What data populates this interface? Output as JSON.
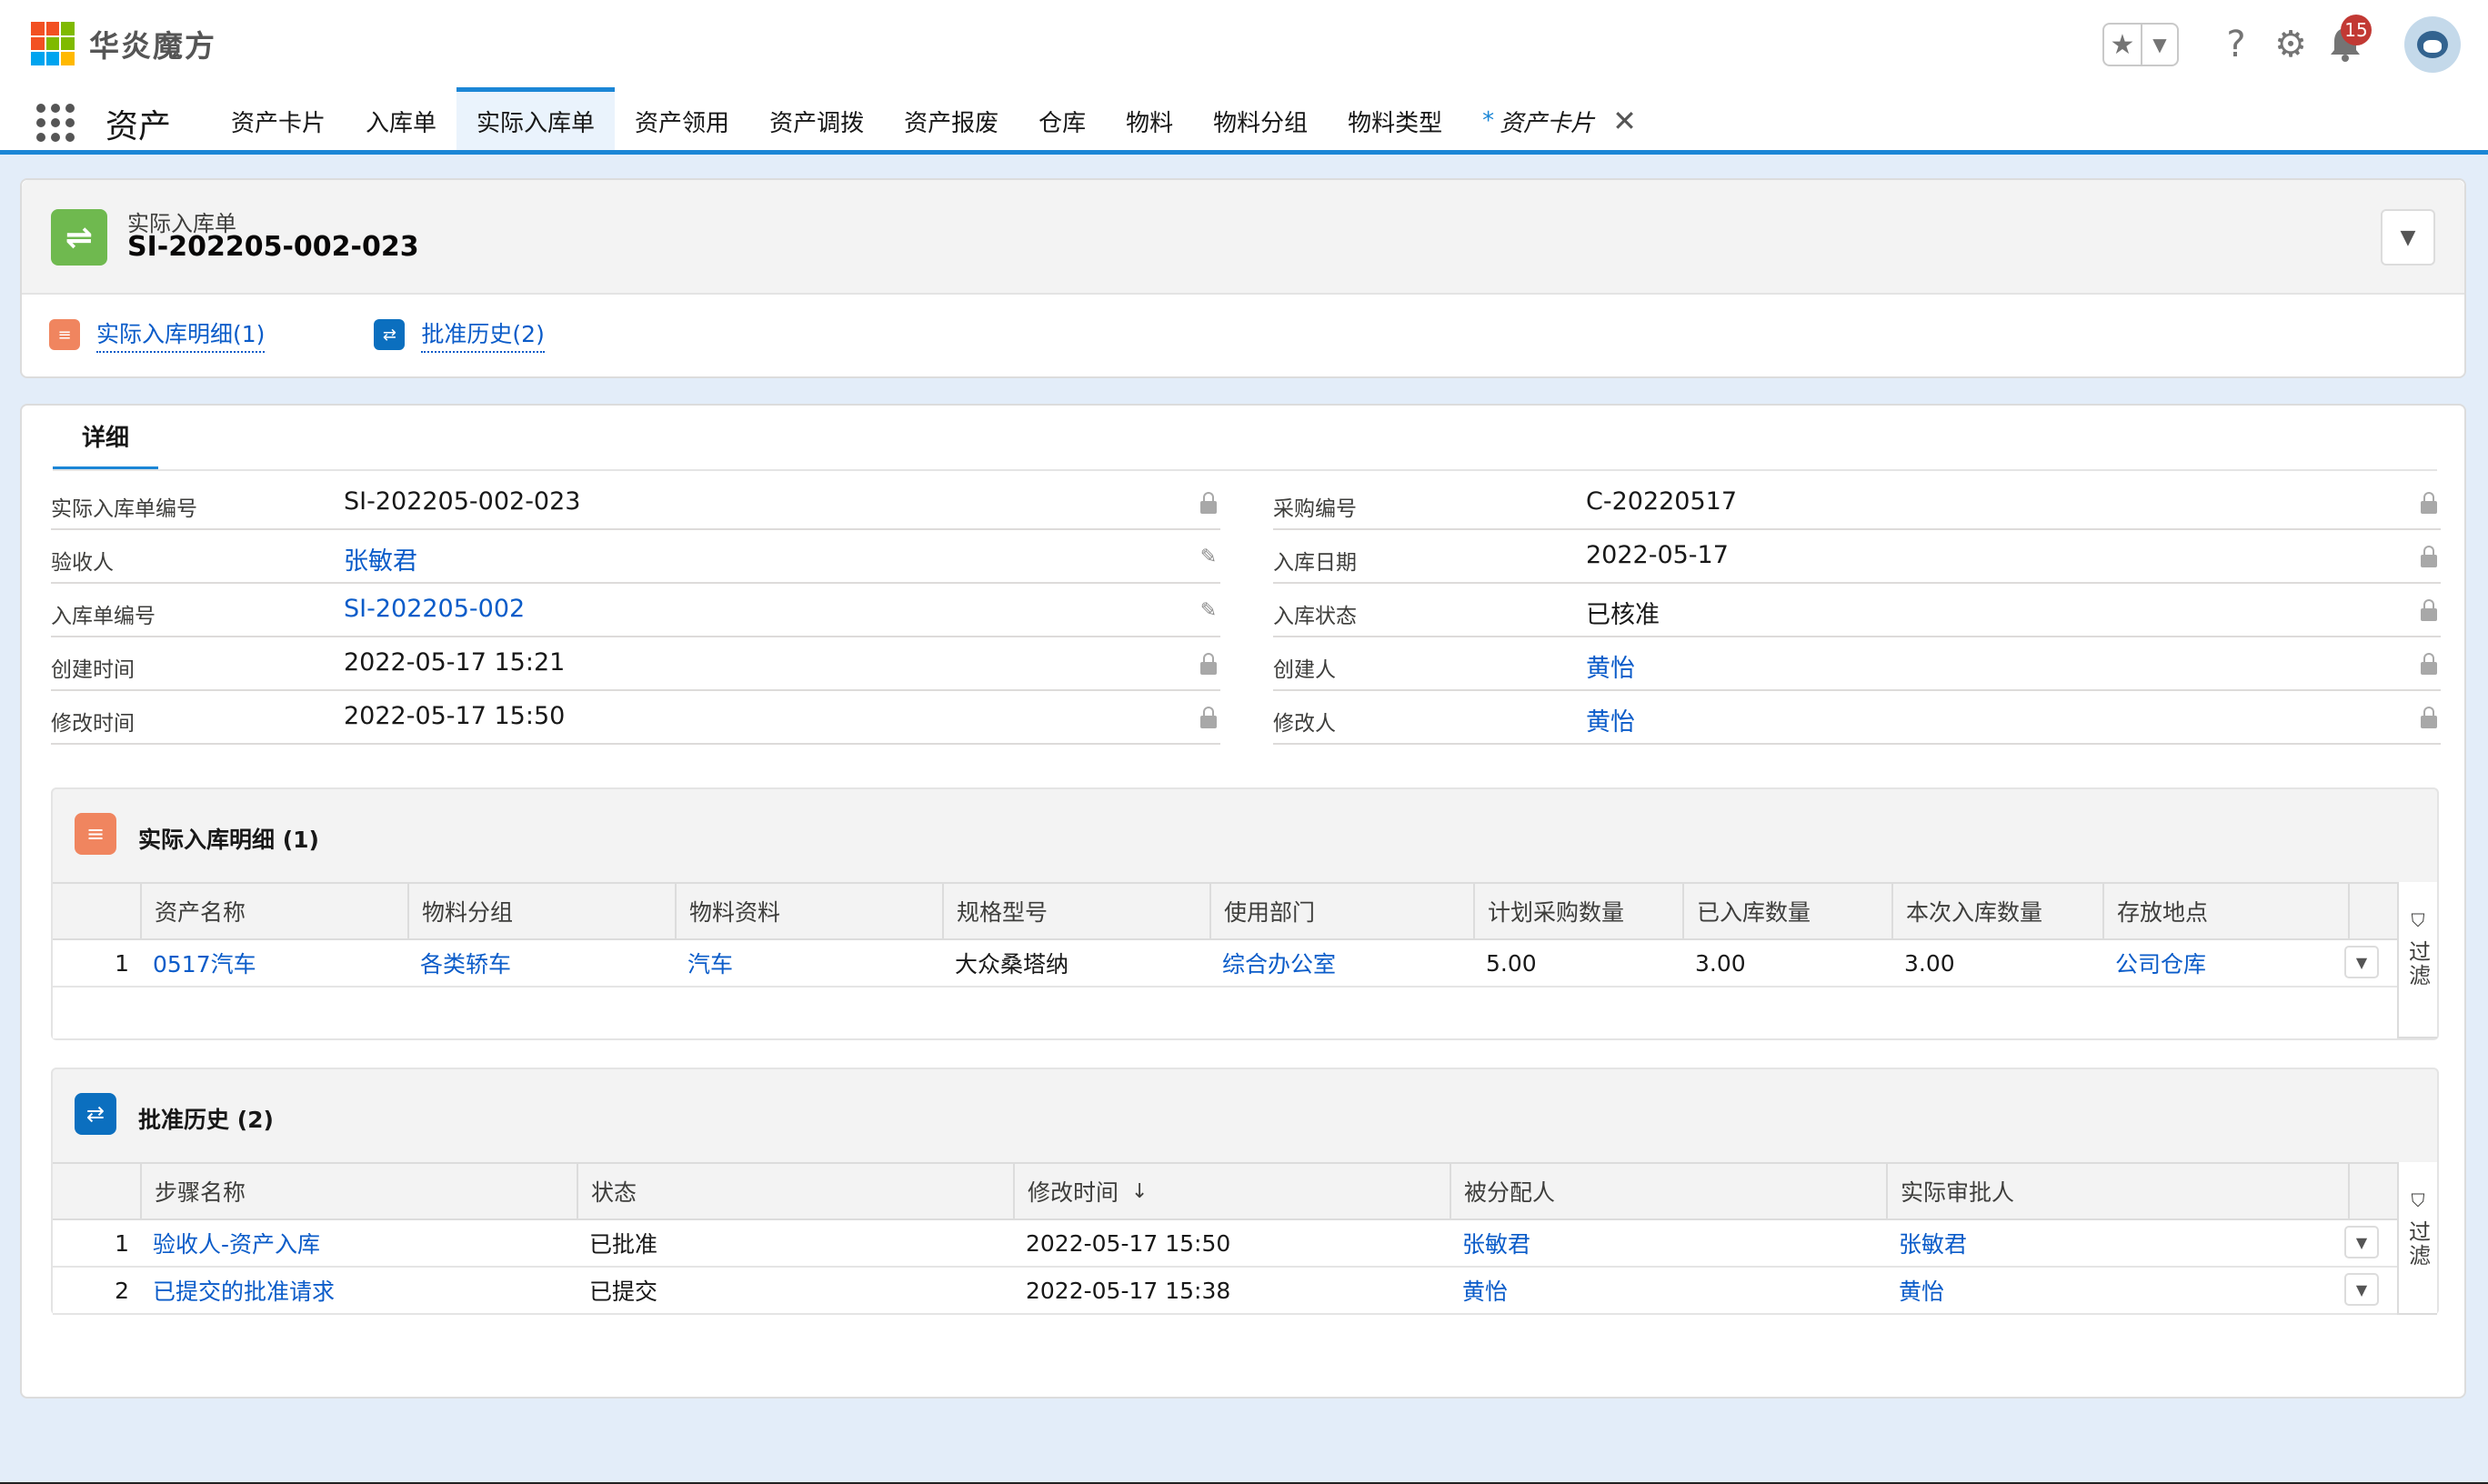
{
  "header": {
    "logo_text": "华炎魔方",
    "logo_colors": [
      "#f25022",
      "#7fba00",
      "#00a4ef",
      "#ffb900"
    ],
    "notification_count": "15",
    "icons": [
      "star-icon",
      "chevron-down-icon",
      "help-icon",
      "gear-icon",
      "bell-icon",
      "avatar"
    ]
  },
  "nav": {
    "app_name": "资产",
    "tabs": [
      {
        "label": "资产卡片"
      },
      {
        "label": "入库单"
      },
      {
        "label": "实际入库单",
        "active": true
      },
      {
        "label": "资产领用"
      },
      {
        "label": "资产调拨"
      },
      {
        "label": "资产报废"
      },
      {
        "label": "仓库"
      },
      {
        "label": "物料"
      },
      {
        "label": "物料分组"
      },
      {
        "label": "物料类型"
      },
      {
        "label": "资产卡片",
        "dirty_marker": "*",
        "closable": true
      }
    ]
  },
  "record": {
    "type_label": "实际入库单",
    "name": "SI-202205-002-023",
    "related_links": [
      {
        "label": "实际入库明细(1)",
        "color": "#f0855f"
      },
      {
        "label": "批准历史(2)",
        "color": "#0b6fbf"
      }
    ]
  },
  "detail": {
    "tab_label": "详细",
    "left_fields": [
      {
        "label": "实际入库单编号",
        "value": "SI-202205-002-023",
        "link": false,
        "icon": "lock"
      },
      {
        "label": "验收人",
        "value": "张敏君",
        "link": true,
        "icon": "edit"
      },
      {
        "label": "入库单编号",
        "value": "SI-202205-002",
        "link": true,
        "icon": "edit"
      },
      {
        "label": "创建时间",
        "value": "2022-05-17 15:21",
        "link": false,
        "icon": "lock"
      },
      {
        "label": "修改时间",
        "value": "2022-05-17 15:50",
        "link": false,
        "icon": "lock"
      }
    ],
    "right_fields": [
      {
        "label": "采购编号",
        "value": "C-20220517",
        "link": false,
        "icon": "lock"
      },
      {
        "label": "入库日期",
        "value": "2022-05-17",
        "link": false,
        "icon": "lock"
      },
      {
        "label": "入库状态",
        "value": "已核准",
        "link": false,
        "icon": "lock"
      },
      {
        "label": "创建人",
        "value": "黄怡",
        "link": true,
        "icon": "lock"
      },
      {
        "label": "修改人",
        "value": "黄怡",
        "link": true,
        "icon": "lock"
      }
    ]
  },
  "detail_list": {
    "title": "实际入库明细 (1)",
    "icon_color": "#f0855f",
    "columns": [
      "资产名称",
      "物料分组",
      "物料资料",
      "规格型号",
      "使用部门",
      "计划采购数量",
      "已入库数量",
      "本次入库数量",
      "存放地点"
    ],
    "rows": [
      {
        "index": "1",
        "cells": [
          "0517汽车",
          "各类轿车",
          "汽车",
          "大众桑塔纳",
          "综合办公室",
          "5.00",
          "3.00",
          "3.00",
          "公司仓库"
        ]
      }
    ],
    "filter_label": "过滤"
  },
  "approval_list": {
    "title": "批准历史 (2)",
    "icon_color": "#0b6fbf",
    "columns": [
      "步骤名称",
      "状态",
      "修改时间",
      "被分配人",
      "实际审批人"
    ],
    "sort_indicator": "↓",
    "rows": [
      {
        "index": "1",
        "cells": [
          "验收人-资产入库",
          "已批准",
          "2022-05-17 15:50",
          "张敏君",
          "张敏君"
        ]
      },
      {
        "index": "2",
        "cells": [
          "已提交的批准请求",
          "已提交",
          "2022-05-17 15:38",
          "黄怡",
          "黄怡"
        ]
      }
    ],
    "filter_label": "过滤"
  }
}
